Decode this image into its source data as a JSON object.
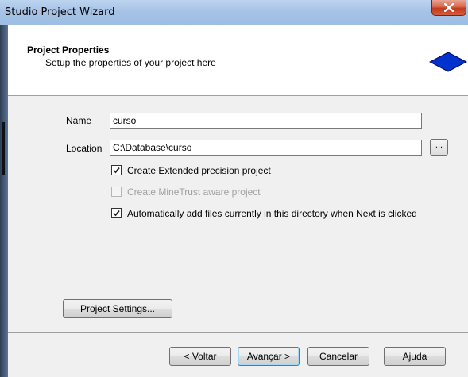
{
  "window": {
    "title": "Studio Project Wizard",
    "close_glyph": "X"
  },
  "header": {
    "title": "Project Properties",
    "subtitle": "Setup the properties of your project here",
    "icon": "blue-diamond-icon",
    "accent_color": "#0033cc"
  },
  "form": {
    "name_label": "Name",
    "name_value": "curso",
    "location_label": "Location",
    "location_value": "C:\\Database\\curso",
    "browse_label": "...",
    "options": [
      {
        "label": "Create Extended precision project",
        "checked": true,
        "enabled": true
      },
      {
        "label": "Create MineTrust aware project",
        "checked": false,
        "enabled": false
      },
      {
        "label": "Automatically add files currently in this directory when Next is clicked",
        "checked": true,
        "enabled": true
      }
    ],
    "project_settings_label": "Project Settings..."
  },
  "footer": {
    "back_label": "< Voltar",
    "next_label": "Avançar >",
    "cancel_label": "Cancelar",
    "help_label": "Ajuda"
  }
}
